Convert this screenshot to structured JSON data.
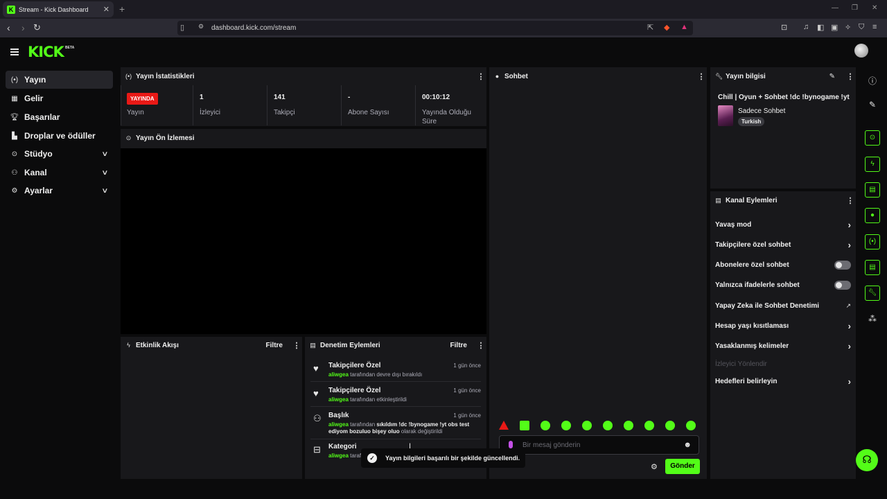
{
  "browser": {
    "tab_title": "Stream - Kick Dashboard",
    "favicon": "K",
    "url": "dashboard.kick.com/stream"
  },
  "header": {
    "logo": "KICK",
    "logo_badge": "BETA"
  },
  "sidebar": {
    "items": [
      {
        "label": "Yayın",
        "icon": "broadcast-icon",
        "active": true
      },
      {
        "label": "Gelir",
        "icon": "revenue-icon"
      },
      {
        "label": "Başarılar",
        "icon": "trophy-icon"
      },
      {
        "label": "Droplar ve ödüller",
        "icon": "gift-icon"
      },
      {
        "label": "Stüdyo",
        "icon": "studio-icon",
        "expandable": true
      },
      {
        "label": "Kanal",
        "icon": "channel-icon",
        "expandable": true
      },
      {
        "label": "Ayarlar",
        "icon": "gear-icon",
        "expandable": true
      }
    ]
  },
  "stats_panel": {
    "title": "Yayın İstatistikleri",
    "live_badge": "YAYINDA",
    "stats": [
      {
        "value": "",
        "label": "Yayın"
      },
      {
        "value": "1",
        "label": "İzleyici"
      },
      {
        "value": "141",
        "label": "Takipçi"
      },
      {
        "value": "-",
        "label": "Abone Sayısı"
      },
      {
        "value": "00:10:12",
        "label": "Yayında Olduğu Süre"
      }
    ]
  },
  "preview_panel": {
    "title": "Yayın Ön İzlemesi"
  },
  "activity_panel": {
    "title": "Etkinlik Akışı",
    "filter": "Filtre"
  },
  "moderation_panel": {
    "title": "Denetim Eylemleri",
    "filter": "Filtre",
    "items": [
      {
        "title": "Takipçilere Özel",
        "time": "1 gün önce",
        "user": "aliwgea",
        "text": "tarafından devre dışı bırakıldı",
        "icon": "heart-icon"
      },
      {
        "title": "Takipçilere Özel",
        "time": "1 gün önce",
        "user": "aliwgea",
        "text": "tarafından etkinleştirildi",
        "icon": "heart-icon"
      },
      {
        "title": "Başlık",
        "time": "1 gün önce",
        "user": "aliwgea",
        "text_pre": "tarafından",
        "highlight": "sıkıldım !dc !bynogame !yt obs test ediyom bozuluo bişey oluo",
        "text_post": "olarak değiştirildi",
        "icon": "user-edit-icon"
      },
      {
        "title": "Kategori",
        "time": "",
        "user": "aliwgea",
        "text": "taraf",
        "icon": "category-icon"
      }
    ]
  },
  "chat_panel": {
    "title": "Sohbet",
    "input_placeholder": "Bir mesaj gönderin",
    "send_label": "Gönder"
  },
  "stream_info": {
    "title": "Yayın bilgisi",
    "stream_title": "Chill | Oyun + Sohbet !dc !bynogame !yt",
    "category": "Sadece Sohbet",
    "tag": "Turkish"
  },
  "channel_actions": {
    "title": "Kanal Eylemleri",
    "items": [
      {
        "label": "Yavaş mod",
        "control": "chevron"
      },
      {
        "label": "Takipçilere özel sohbet",
        "control": "chevron"
      },
      {
        "label": "Abonelere özel sohbet",
        "control": "toggle",
        "on": false
      },
      {
        "label": "Yalnızca ifadelerle sohbet",
        "control": "toggle",
        "on": false
      },
      {
        "label": "Yapay Zeka ile Sohbet Denetimi",
        "control": "external"
      },
      {
        "label": "Hesap yaşı kısıtlaması",
        "control": "chevron"
      },
      {
        "label": "Yasaklanmış kelimeler",
        "control": "chevron"
      },
      {
        "label": "İzleyici Yönlendir",
        "control": "none",
        "disabled": true
      },
      {
        "label": "Hedefleri belirleyin",
        "control": "chevron"
      }
    ]
  },
  "toast": {
    "message": "Yayın bilgileri başarılı bir şekilde güncellendi."
  },
  "colors": {
    "accent": "#53fc18",
    "live": "#e91916",
    "panel": "#18181b",
    "background": "#0b0b0c"
  }
}
